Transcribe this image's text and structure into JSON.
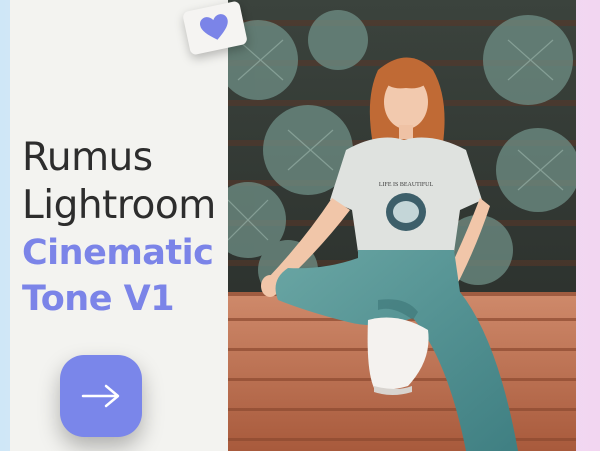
{
  "title": {
    "line1": "Rumus",
    "line2": "Lightroom",
    "line3": "Cinematic",
    "line4": "Tone V1"
  },
  "photo": {
    "tshirt_text": "LIFE IS BEAUTIFUL"
  },
  "icons": {
    "heart": "heart-icon",
    "arrow": "arrow-right-icon"
  },
  "colors": {
    "accent": "#7b84e8",
    "title": "#2d2d2d",
    "card": "#f3f3f0"
  }
}
